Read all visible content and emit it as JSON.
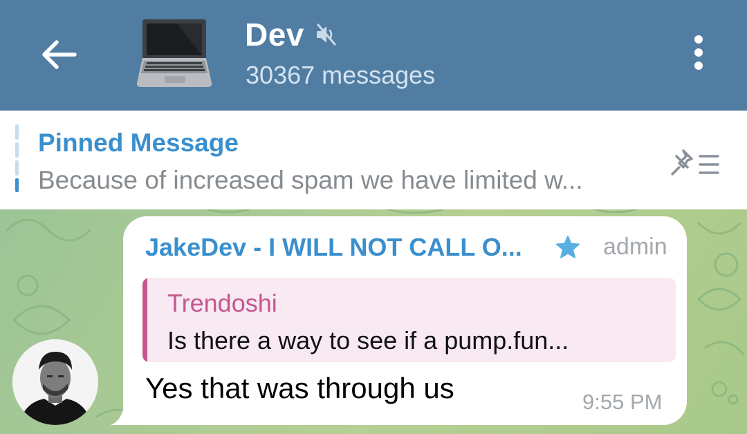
{
  "header": {
    "back_icon": "arrow-left-icon",
    "chat_avatar_icon": "laptop-emoji",
    "title": "Dev",
    "muted_icon": "muted-speaker-icon",
    "subtitle": "30367 messages",
    "menu_icon": "more-vertical-icon"
  },
  "pinned": {
    "title": "Pinned Message",
    "text": "Because of increased spam we have limited w...",
    "list_icon": "pin-list-icon"
  },
  "message": {
    "sender": "JakeDev - I WILL NOT CALL O...",
    "badge_icon": "star-icon",
    "role": "admin",
    "reply": {
      "name": "Trendoshi",
      "text": "Is there a way to see if a pump.fun..."
    },
    "text": "Yes that was through us",
    "time": "9:55 PM",
    "avatar": "user-photo"
  },
  "colors": {
    "header_bg": "#517da2",
    "accent_blue": "#3a8fce",
    "reply_pink": "#c4578f",
    "reply_bg": "#f8e9f2",
    "chat_bg": "#a9c98e"
  }
}
